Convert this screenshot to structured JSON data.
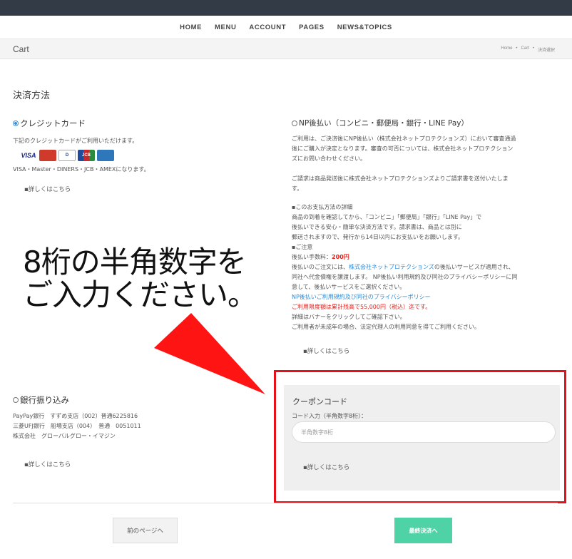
{
  "nav": [
    "HOME",
    "MENU",
    "ACCOUNT",
    "PAGES",
    "NEWS&TOPICS"
  ],
  "subhead": {
    "title": "Cart",
    "breadcrumb": [
      "Home",
      "•",
      "Cart",
      "•",
      "決済選択"
    ]
  },
  "section_title": "決済方法",
  "credit": {
    "label": "クレジットカード",
    "desc": "下記のクレジットカードがご利用いただけます。",
    "cards": [
      "VISA",
      "MasterCard",
      "DINERS",
      "JCB",
      "AMEX"
    ],
    "brands": "VISA・Master・DINERS・JCB・AMEXになります。",
    "detail": "▪詳しくはこちら"
  },
  "np": {
    "label": "NP後払い（コンビニ・郵便局・銀行・LINE Pay）",
    "p1": [
      "ご利用は、ご決済後にNP後払い（株式会社ネットプロテクションズ）において審査通過",
      "後にご購入が決定となります。審査の可否については、株式会社ネットプロテクション",
      "ズにお問い合わせください。"
    ],
    "p2": [
      "ご請求は商品発送後に株式会社ネットプロテクションズよりご請求書を送付いたしま",
      "す。"
    ],
    "details_heading": "▪このお支払方法の詳細",
    "p3": [
      "商品の到着を確認してから、「コンビニ」「郵便局」「銀行」「LINE Pay」で",
      "後払いできる安心・簡単な決済方法です。請求書は、商品とは別に",
      "郵送されますので、発行から14日以内にお支払いをお願いします。"
    ],
    "notice_heading": "▪ご注意",
    "fee_label": "後払い手数料：",
    "fee": "200円",
    "p4_a": "後払いのご注文には、",
    "p4_link": "株式会社ネットプロテクションズ",
    "p4_b": "の後払いサービスが適用され、",
    "p4_c": [
      "同社へ代金債権を譲渡します。 NP後払い利用規約及び同社のプライバシーポリシーに同",
      "意して、後払いサービスをご選択ください。"
    ],
    "terms_link": "NP後払いご利用規約及び同社のプライバシーポリシー",
    "limit": "ご利用限度額は累計残高で55,000円（税込）迄です。",
    "p5": [
      "詳細はバナーをクリックしてご確認下さい。",
      "ご利用者が未成年の場合、法定代理人の利用同意を得てご利用ください。"
    ],
    "detail": "▪詳しくはこちら"
  },
  "bank": {
    "label": "銀行振り込み",
    "lines": [
      "PayPay銀行　すずめ支店（002）普通6225816",
      "三菱UFJ銀行　船場支店（004）　普通　0051011",
      "株式会社　グローバルグロー・イマジン"
    ],
    "detail": "▪詳しくはこちら"
  },
  "overlay": {
    "line1": "8桁の半角数字を",
    "line2": "ご入力ください。"
  },
  "coupon": {
    "title": "クーポンコード",
    "label": "コード入力（半角数字8桁）：",
    "placeholder": "半角数字8桁",
    "detail": "▪詳しくはこちら"
  },
  "buttons": {
    "prev": "前のページへ",
    "final": "最終決済へ"
  },
  "colors": {
    "topbar": "#333b47",
    "accent_red": "#e5101a",
    "final_button": "#4fd3a6",
    "link_blue": "#2b8ad7"
  }
}
